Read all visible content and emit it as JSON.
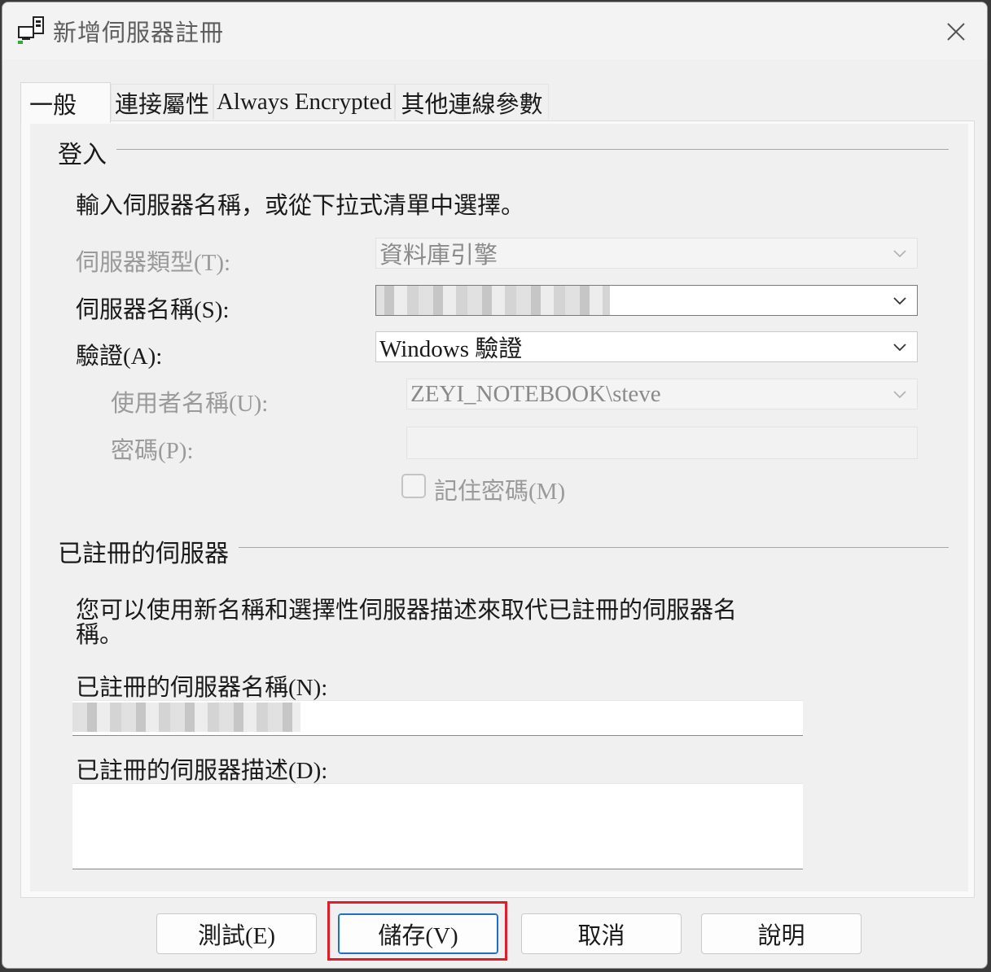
{
  "window": {
    "title": "新增伺服器註冊",
    "icons": {
      "app": "server-register-icon",
      "close": "close-icon"
    }
  },
  "tabs": [
    {
      "label": "一般",
      "active": true
    },
    {
      "label": "連接屬性",
      "active": false
    },
    {
      "label": "Always Encrypted",
      "active": false
    },
    {
      "label": "其他連線參數",
      "active": false
    }
  ],
  "login": {
    "group_title": "登入",
    "instruction": "輸入伺服器名稱，或從下拉式清單中選擇。",
    "server_type_label": "伺服器類型(T):",
    "server_type_value": "資料庫引擎",
    "server_name_label": "伺服器名稱(S):",
    "auth_label": "驗證(A):",
    "auth_value": "Windows 驗證",
    "username_label": "使用者名稱(U):",
    "username_value": "ZEYI_NOTEBOOK\\steve",
    "password_label": "密碼(P):",
    "remember_password_label": "記住密碼(M)"
  },
  "registered": {
    "group_title": "已註冊的伺服器",
    "description_line1": "您可以使用新名稱和選擇性伺服器描述來取代已註冊的伺服器名",
    "description_line2": "稱。",
    "name_label": "已註冊的伺服器名稱(N):",
    "desc_label": "已註冊的伺服器描述(D):"
  },
  "buttons": {
    "test": "測試(E)",
    "save": "儲存(V)",
    "cancel": "取消",
    "help": "說明"
  },
  "colors": {
    "highlight": "#e01e2b",
    "primary_button_border": "#1f6fc4"
  }
}
